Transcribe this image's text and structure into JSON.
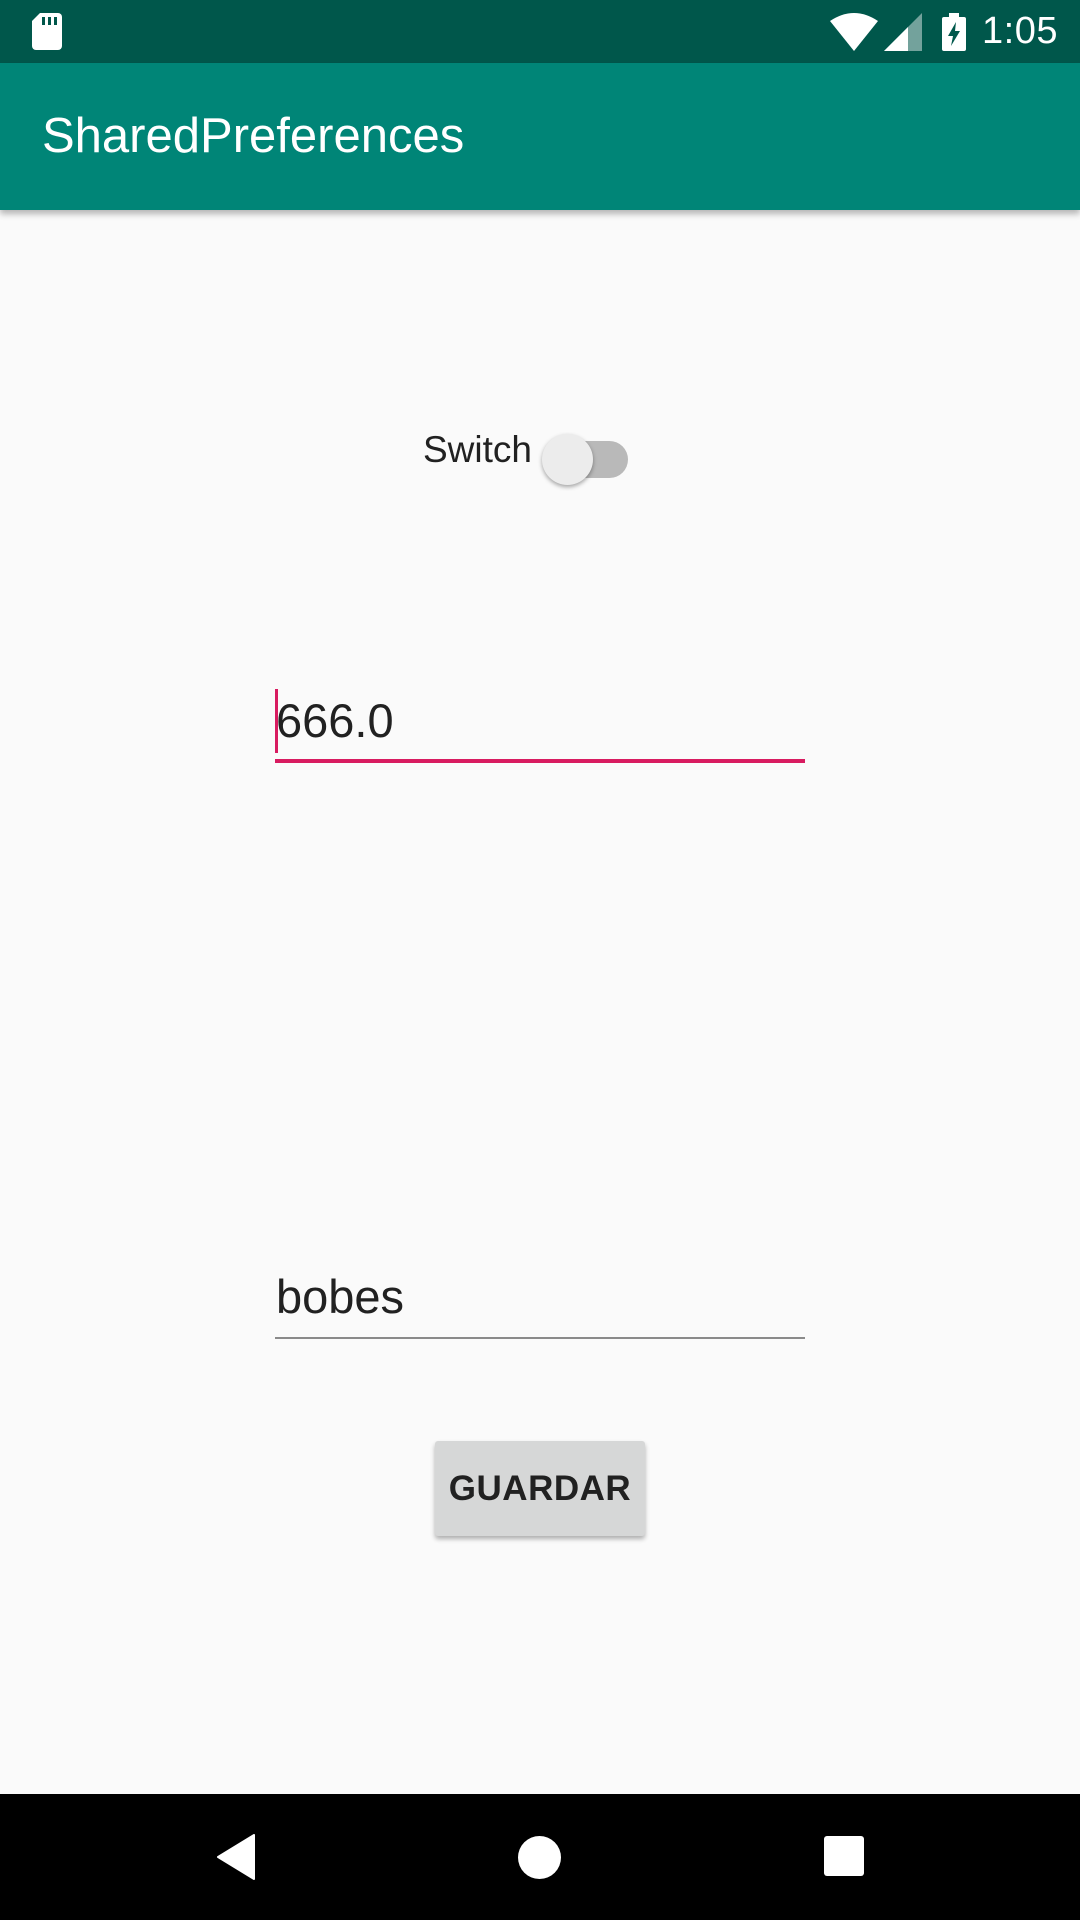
{
  "status_bar": {
    "time": "1:05",
    "icons": [
      "sd-card-icon",
      "wifi-icon",
      "cell-signal-icon",
      "battery-charging-icon"
    ]
  },
  "app_bar": {
    "title": "SharedPreferences"
  },
  "form": {
    "switch": {
      "label": "Switch",
      "checked": false
    },
    "number_field": {
      "value": "666.0",
      "focused": true
    },
    "text_field": {
      "value": "bobes"
    },
    "save_button": {
      "label": "GUARDAR"
    }
  },
  "nav_bar": {
    "icons": [
      "back-icon",
      "home-icon",
      "recents-icon"
    ]
  },
  "colors": {
    "status_bar": "#00574b",
    "app_bar": "#008577",
    "accent": "#d81b60",
    "background": "#fafafa"
  }
}
